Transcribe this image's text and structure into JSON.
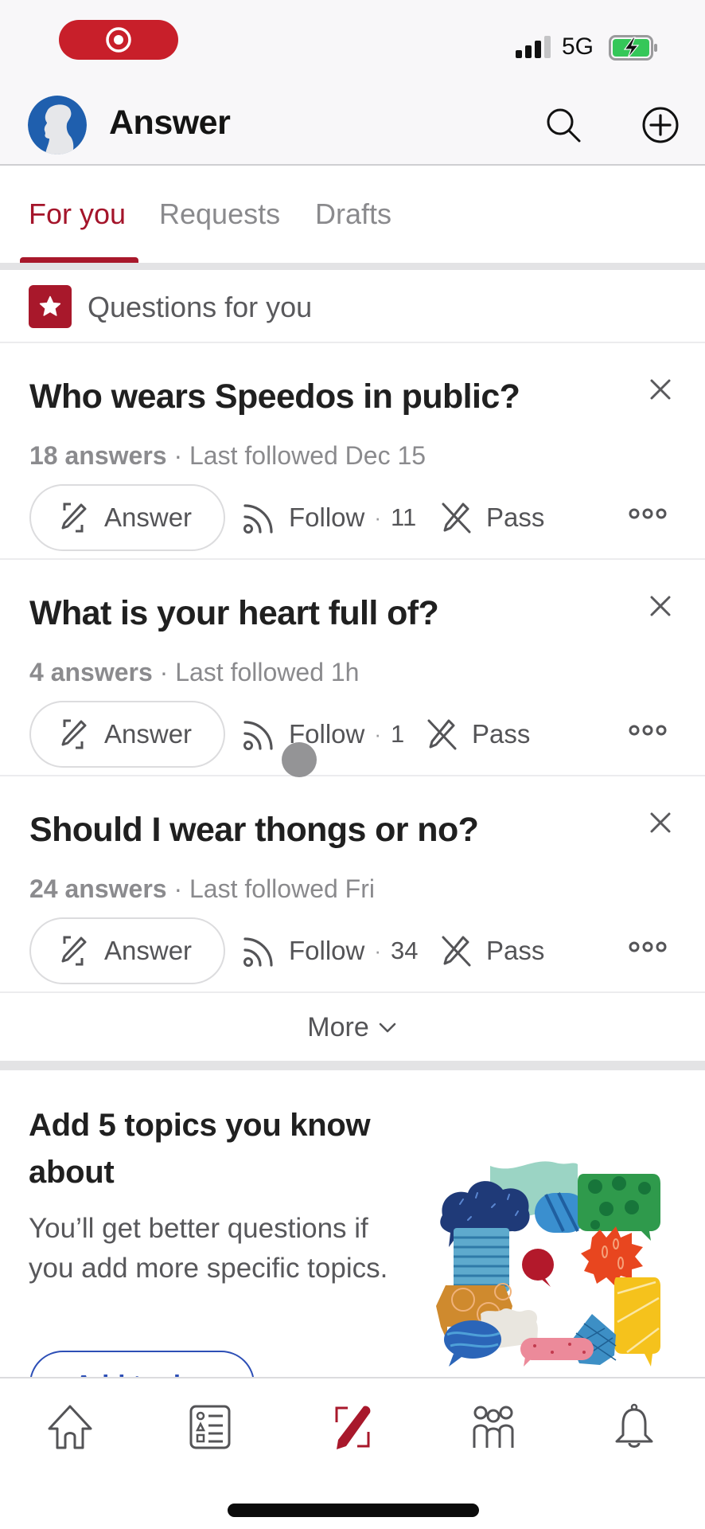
{
  "status_bar": {
    "recording_indicator": "record-icon",
    "network": "5G",
    "signal_bars_filled": 3,
    "signal_bars_total": 4,
    "battery_state": "charging"
  },
  "header": {
    "title": "Answer",
    "avatar": "user-avatar",
    "actions": [
      {
        "name": "search",
        "icon": "search-icon"
      },
      {
        "name": "add",
        "icon": "plus-circle-icon"
      }
    ]
  },
  "tabs": [
    {
      "label": "For you",
      "active": true
    },
    {
      "label": "Requests",
      "active": false
    },
    {
      "label": "Drafts",
      "active": false
    }
  ],
  "section": {
    "title": "Questions for you",
    "icon": "star-icon"
  },
  "questions": [
    {
      "title": "Who wears Speedos in public?",
      "answers": "18 answers",
      "separator": "·",
      "last_followed": "Last followed Dec 15",
      "answer_label": "Answer",
      "follow_label": "Follow",
      "follow_count": "11",
      "pass_label": "Pass"
    },
    {
      "title": "What is your heart full of?",
      "answers": "4 answers",
      "separator": "·",
      "last_followed": "Last followed 1h",
      "answer_label": "Answer",
      "follow_label": "Follow",
      "follow_count": "1",
      "pass_label": "Pass"
    },
    {
      "title": "Should I wear thongs or no?",
      "answers": "24 answers",
      "separator": "·",
      "last_followed": "Last followed Fri",
      "answer_label": "Answer",
      "follow_label": "Follow",
      "follow_count": "34",
      "pass_label": "Pass"
    }
  ],
  "more": {
    "label": "More"
  },
  "topics_card": {
    "title": "Add 5 topics you know about",
    "body": "You’ll get better questions if you add more specific topics.",
    "button_label": "Add topics",
    "illustration": "speech-bubbles-illustration"
  },
  "bottom_nav": [
    {
      "name": "home",
      "icon": "home-icon",
      "active": false
    },
    {
      "name": "following",
      "icon": "list-icon",
      "active": false
    },
    {
      "name": "answer",
      "icon": "pen-square-icon",
      "active": true
    },
    {
      "name": "spaces",
      "icon": "people-icon",
      "active": false
    },
    {
      "name": "notifications",
      "icon": "bell-icon",
      "active": false
    }
  ],
  "colors": {
    "brand": "#a8182b",
    "recording": "#c81f2a",
    "link_blue": "#2d4fb6",
    "battery_green": "#35c759"
  }
}
